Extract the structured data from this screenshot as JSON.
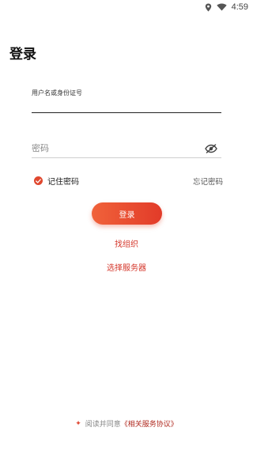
{
  "status_bar": {
    "time": "4:59",
    "icons": [
      "location-icon",
      "wifi-icon"
    ]
  },
  "page": {
    "title": "登录"
  },
  "form": {
    "username_label": "用户名或身份证号",
    "username_value": "",
    "password_placeholder": "密码",
    "password_visibility_icon": "eye-slash-icon",
    "remember_checked": true,
    "remember_label": "记住密码",
    "forgot_label": "忘记密码",
    "login_label": "登录"
  },
  "links": {
    "find_org": "找组织",
    "select_server": "选择服务器"
  },
  "agreement": {
    "prefix": "阅读并同意",
    "link": "《相关服务协议》"
  },
  "colors": {
    "accent": "#e23b29",
    "accent_light": "#f0623a",
    "link_red": "#d4362a"
  }
}
